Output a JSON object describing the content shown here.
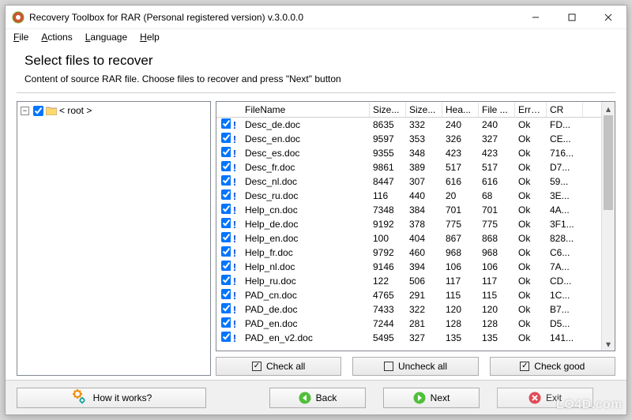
{
  "window": {
    "title": "Recovery Toolbox for RAR (Personal registered version) v.3.0.0.0"
  },
  "menu": {
    "file": "File",
    "actions": "Actions",
    "language": "Language",
    "help": "Help"
  },
  "page": {
    "title": "Select files to recover",
    "subtitle": "Content of source RAR file. Choose files to recover and press \"Next\" button"
  },
  "tree": {
    "root_label": "< root >"
  },
  "columns": {
    "c0": "",
    "c1": "",
    "c2": "FileName",
    "c3": "Size...",
    "c4": "Size...",
    "c5": "Hea...",
    "c6": "File ...",
    "c7": "Erro...",
    "c8": "CR"
  },
  "files": [
    {
      "name": "Desc_de.doc",
      "s1": "8635",
      "s2": "332",
      "s3": "240",
      "s4": "240",
      "err": "Ok",
      "crc": "FD..."
    },
    {
      "name": "Desc_en.doc",
      "s1": "9597",
      "s2": "353",
      "s3": "326",
      "s4": "327",
      "err": "Ok",
      "crc": "CE..."
    },
    {
      "name": "Desc_es.doc",
      "s1": "9355",
      "s2": "348",
      "s3": "423",
      "s4": "423",
      "err": "Ok",
      "crc": "716..."
    },
    {
      "name": "Desc_fr.doc",
      "s1": "9861",
      "s2": "389",
      "s3": "517",
      "s4": "517",
      "err": "Ok",
      "crc": "D7..."
    },
    {
      "name": "Desc_nl.doc",
      "s1": "8447",
      "s2": "307",
      "s3": "616",
      "s4": "616",
      "err": "Ok",
      "crc": "59..."
    },
    {
      "name": "Desc_ru.doc",
      "s1": "116",
      "s2": "440",
      "s3": "20",
      "s4": "68",
      "err": "Ok",
      "crc": "3E..."
    },
    {
      "name": "Help_cn.doc",
      "s1": "7348",
      "s2": "384",
      "s3": "701",
      "s4": "701",
      "err": "Ok",
      "crc": "4A..."
    },
    {
      "name": "Help_de.doc",
      "s1": "9192",
      "s2": "378",
      "s3": "775",
      "s4": "775",
      "err": "Ok",
      "crc": "3F1..."
    },
    {
      "name": "Help_en.doc",
      "s1": "100",
      "s2": "404",
      "s3": "867",
      "s4": "868",
      "err": "Ok",
      "crc": "828..."
    },
    {
      "name": "Help_fr.doc",
      "s1": "9792",
      "s2": "460",
      "s3": "968",
      "s4": "968",
      "err": "Ok",
      "crc": "C6..."
    },
    {
      "name": "Help_nl.doc",
      "s1": "9146",
      "s2": "394",
      "s3": "106",
      "s4": "106",
      "err": "Ok",
      "crc": "7A..."
    },
    {
      "name": "Help_ru.doc",
      "s1": "122",
      "s2": "506",
      "s3": "117",
      "s4": "117",
      "err": "Ok",
      "crc": "CD..."
    },
    {
      "name": "PAD_cn.doc",
      "s1": "4765",
      "s2": "291",
      "s3": "115",
      "s4": "115",
      "err": "Ok",
      "crc": "1C..."
    },
    {
      "name": "PAD_de.doc",
      "s1": "7433",
      "s2": "322",
      "s3": "120",
      "s4": "120",
      "err": "Ok",
      "crc": "B7..."
    },
    {
      "name": "PAD_en.doc",
      "s1": "7244",
      "s2": "281",
      "s3": "128",
      "s4": "128",
      "err": "Ok",
      "crc": "D5..."
    },
    {
      "name": "PAD_en_v2.doc",
      "s1": "5495",
      "s2": "327",
      "s3": "135",
      "s4": "135",
      "err": "Ok",
      "crc": "141..."
    }
  ],
  "buttons": {
    "check_all": "Check all",
    "uncheck_all": "Uncheck all",
    "check_good": "Check good",
    "how": "How it works?",
    "back": "Back",
    "next": "Next",
    "exit": "Exit"
  },
  "watermark": "LO4D.com"
}
